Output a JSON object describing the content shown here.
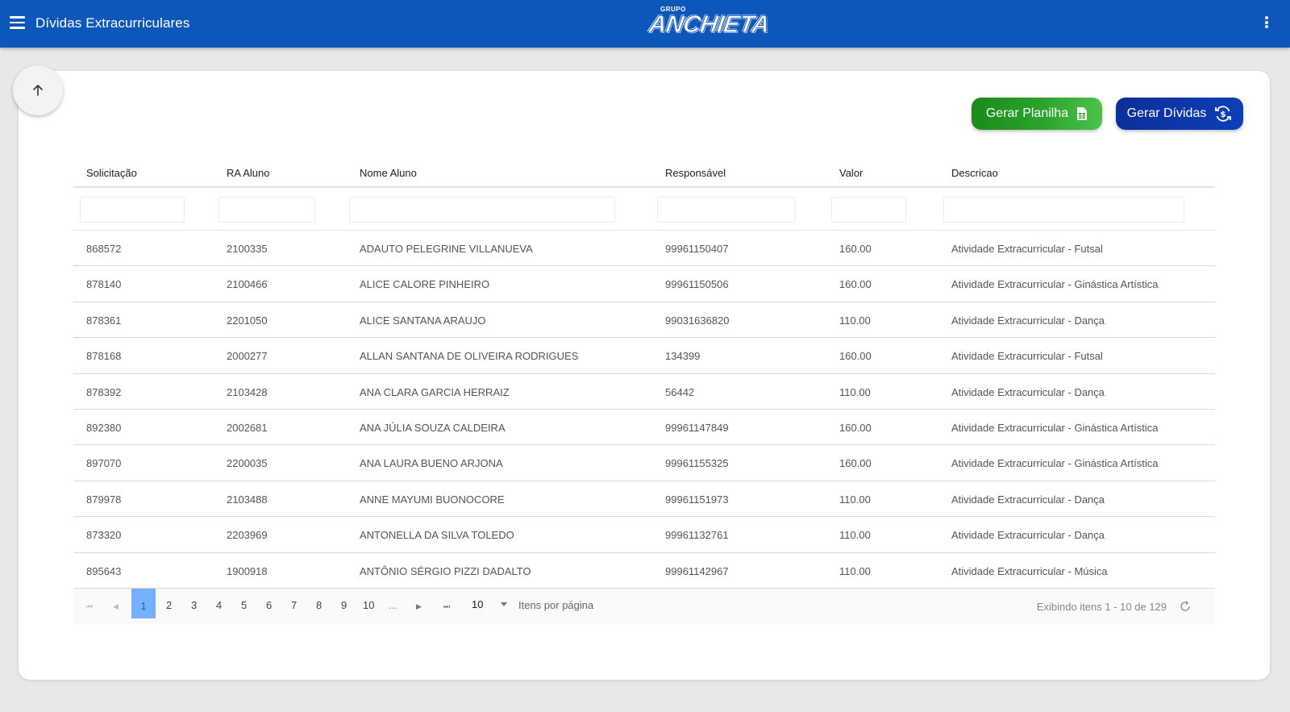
{
  "header": {
    "title": "Dívidas Extracurriculares",
    "logo_small": "GRUPO",
    "logo_main": "ANCHIETA"
  },
  "actions": {
    "planilha_label": "Gerar Planilha",
    "dividas_label": "Gerar Dívidas"
  },
  "table": {
    "columns": [
      "Solicitação",
      "RA Aluno",
      "Nome Aluno",
      "Responsável",
      "Valor",
      "Descricao"
    ],
    "rows": [
      [
        "868572",
        "2100335",
        "ADAUTO PELEGRINE VILLANUEVA",
        "99961150407",
        "160.00",
        "Atividade Extracurricular - Futsal"
      ],
      [
        "878140",
        "2100466",
        "ALICE CALORE PINHEIRO",
        "99961150506",
        "160.00",
        "Atividade Extracurricular - Ginástica Artística"
      ],
      [
        "878361",
        "2201050",
        "ALICE SANTANA ARAUJO",
        "99031636820",
        "110.00",
        "Atividade Extracurricular - Dança"
      ],
      [
        "878168",
        "2000277",
        "ALLAN SANTANA DE OLIVEIRA RODRIGUES",
        "134399",
        "160.00",
        "Atividade Extracurricular - Futsal"
      ],
      [
        "878392",
        "2103428",
        "ANA CLARA GARCIA HERRAIZ",
        "56442",
        "110.00",
        "Atividade Extracurricular - Dança"
      ],
      [
        "892380",
        "2002681",
        "ANA JÚLIA SOUZA CALDEIRA",
        "99961147849",
        "160.00",
        "Atividade Extracurricular - Ginástica Artística"
      ],
      [
        "897070",
        "2200035",
        "ANA LAURA BUENO ARJONA",
        "99961155325",
        "160.00",
        "Atividade Extracurricular - Ginástica Artística"
      ],
      [
        "879978",
        "2103488",
        "ANNE MAYUMI BUONOCORE",
        "99961151973",
        "110.00",
        "Atividade Extracurricular - Dança"
      ],
      [
        "873320",
        "2203969",
        "ANTONELLA DA SILVA TOLEDO",
        "99961132761",
        "110.00",
        "Atividade Extracurricular - Dança"
      ],
      [
        "895643",
        "1900918",
        "ANTÔNIO SÉRGIO PIZZI DADALTO",
        "99961142967",
        "110.00",
        "Atividade Extracurricular - Música"
      ]
    ]
  },
  "pager": {
    "current": "1",
    "pages": [
      "2",
      "3",
      "4",
      "5",
      "6",
      "7",
      "8",
      "9",
      "10",
      "..."
    ],
    "page_size": "10",
    "page_size_label": "Itens por página",
    "info": "Exibindo itens 1 - 10 de 129"
  },
  "colors": {
    "topbar": "#0d57bb",
    "green_button": "#2aa52a",
    "blue_button": "#0c3fb6",
    "selected_page": "#76b1ff"
  },
  "icons": {
    "menu": "hamburger-menu-icon",
    "more": "kebab-menu-icon",
    "scroll_top": "arrow-up-icon",
    "sheet": "spreadsheet-file-icon",
    "generate": "currency-refresh-icon",
    "refresh": "refresh-icon"
  }
}
